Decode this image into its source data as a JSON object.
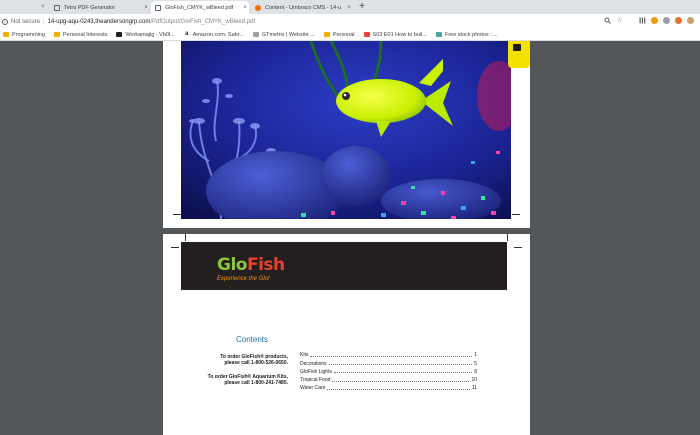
{
  "browser": {
    "tabs": [
      {
        "title": "Tetra PDF Generator",
        "favicon_color": "#5f6368",
        "active": false
      },
      {
        "title": "GloFish_CMYK_wBleed.pdf",
        "favicon_color": "#5f6368",
        "active": true
      },
      {
        "title": "Content - Umbraco CMS - 14-u",
        "favicon_color": "#e8710a",
        "active": false
      }
    ],
    "new_tab": "+",
    "close": "×",
    "address": {
      "security_label": "Not secure",
      "host": "14-upg-aqu-0243.theandersongrp.com",
      "path": "/PdfOutput/GloFish_CMYK_wBleed.pdf"
    },
    "toolbar_icons": [
      "search-icon",
      "star-icon",
      "library-icon",
      "extension-icon",
      "extension-icon",
      "extension-icon",
      "account-icon"
    ],
    "bookmarks": [
      {
        "label": "Programming",
        "icon_color": "#f9ab00"
      },
      {
        "label": "Personal Interests",
        "icon_color": "#f9ab00"
      },
      {
        "label": "Workamajig - Vb0l...",
        "icon_color": "#202124"
      },
      {
        "label": "Amazon.com: Sabr...",
        "icon_color": "#202124"
      },
      {
        "label": "GTmetrix | Website ...",
        "icon_color": "#9aa0a6"
      },
      {
        "label": "Personal",
        "icon_color": "#f9ab00"
      },
      {
        "label": "S03 E01 How to buil...",
        "icon_color": "#ea4335"
      },
      {
        "label": "Free stock photos : ...",
        "icon_color": "#3ea99f"
      }
    ]
  },
  "document": {
    "brand": {
      "name_part1": "Glo",
      "name_part2": "Fish",
      "tagline": "Experience the Glo!",
      "glo_color": "#8cc63f",
      "fish_color": "#e8412d",
      "tagline_color": "#f7941d"
    },
    "contents_title": "Contents",
    "order_products": {
      "line1": "To order GloFish® products,",
      "line2": "please call 1-800-526-0650."
    },
    "order_kits": {
      "line1": "To order GloFish® Aquarium Kits,",
      "line2": "please call 1-800-241-7485."
    },
    "toc": [
      {
        "label": "Kits",
        "page": "1"
      },
      {
        "label": "Decorations",
        "page": "5"
      },
      {
        "label": "GloFish Lights",
        "page": "8"
      },
      {
        "label": "Tropical Food",
        "page": "10"
      },
      {
        "label": "Water Care",
        "page": "11"
      }
    ],
    "colors": {
      "contents_title": "#2f6fa3",
      "viewer_bg": "#525659",
      "banner_bg": "#221f1e"
    }
  }
}
